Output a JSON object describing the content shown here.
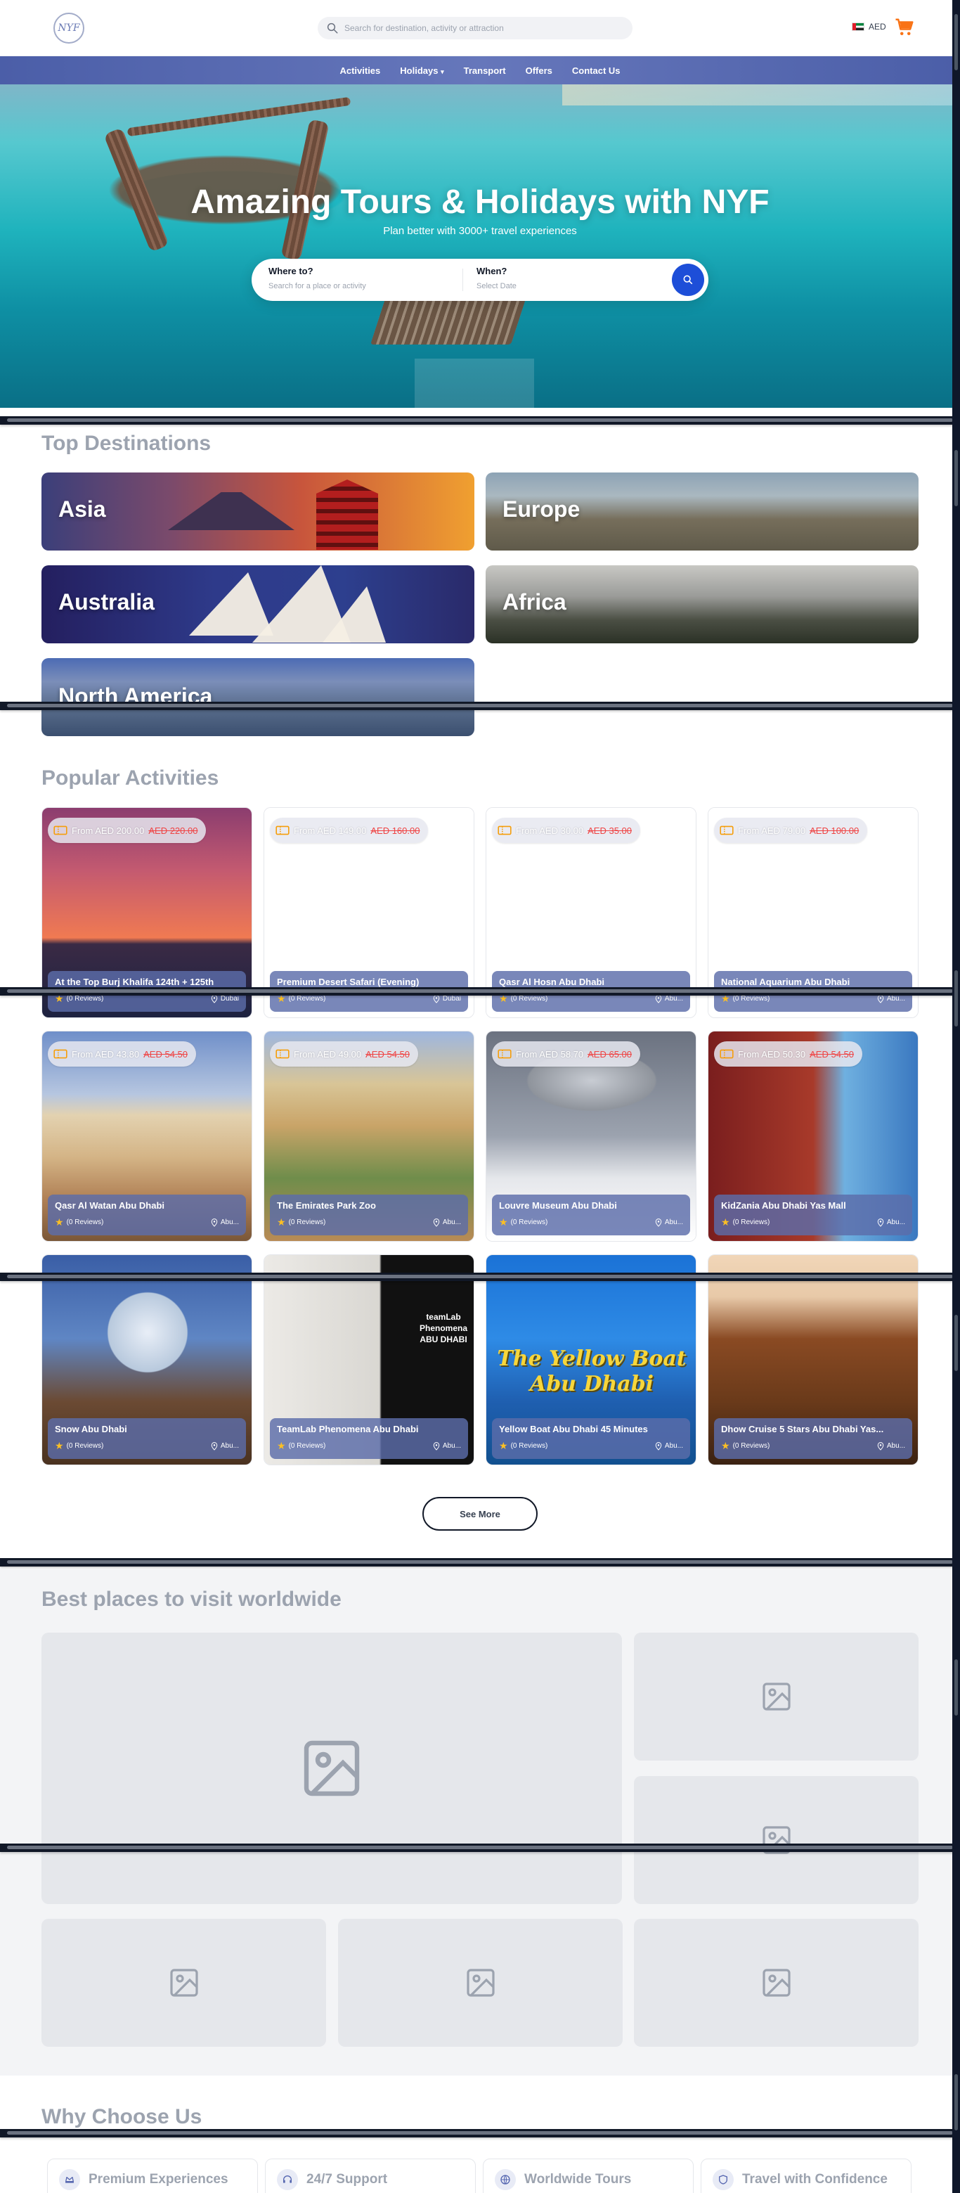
{
  "header": {
    "logo_text": "NYF",
    "search_placeholder": "Search for destination, activity or attraction",
    "currency": "AED"
  },
  "nav": {
    "items": [
      "Activities",
      "Holidays",
      "Transport",
      "Offers",
      "Contact Us"
    ]
  },
  "hero": {
    "title": "Amazing Tours & Holidays with NYF",
    "subtitle": "Plan better with 3000+ travel experiences",
    "where_label": "Where to?",
    "where_placeholder": "Search for a place or activity",
    "when_label": "When?",
    "when_placeholder": "Select Date"
  },
  "destinations": {
    "title": "Top Destinations",
    "items": [
      "Asia",
      "Europe",
      "Australia",
      "Africa",
      "North America"
    ]
  },
  "activities": {
    "title": "Popular Activities",
    "from_prefix": "From",
    "reviews_label": "(0 Reviews)",
    "see_more": "See More",
    "items": [
      {
        "title": "At the Top Burj Khalifa 124th + 125th",
        "price": "AED 200.00",
        "old_price": "AED 220.00",
        "location": "Dubai"
      },
      {
        "title": "Premium Desert Safari (Evening)",
        "price": "AED 149.00",
        "old_price": "AED 160.00",
        "location": "Dubai"
      },
      {
        "title": "Qasr Al Hosn Abu Dhabi",
        "price": "AED 30.00",
        "old_price": "AED 35.00",
        "location": "Abu..."
      },
      {
        "title": "National Aquarium Abu Dhabi",
        "price": "AED 79.00",
        "old_price": "AED 100.00",
        "location": "Abu..."
      },
      {
        "title": "Qasr Al Watan Abu Dhabi",
        "price": "AED 43.80",
        "old_price": "AED 54.50",
        "location": "Abu..."
      },
      {
        "title": "The Emirates Park Zoo",
        "price": "AED 49.00",
        "old_price": "AED 54.50",
        "location": "Abu..."
      },
      {
        "title": "Louvre Museum Abu Dhabi",
        "price": "AED 58.70",
        "old_price": "AED 65.00",
        "location": "Abu..."
      },
      {
        "title": "KidZania Abu Dhabi Yas Mall",
        "price": "AED 50.30",
        "old_price": "AED 54.50",
        "location": "Abu..."
      },
      {
        "title": "Snow Abu Dhabi",
        "price": "",
        "old_price": "",
        "location": "Abu..."
      },
      {
        "title": "TeamLab Phenomena Abu Dhabi",
        "price": "",
        "old_price": "",
        "location": "Abu..."
      },
      {
        "title": "Yellow Boat Abu Dhabi 45 Minutes",
        "price": "",
        "old_price": "",
        "location": "Abu..."
      },
      {
        "title": "Dhow Cruise 5 Stars Abu Dhabi Yas...",
        "price": "",
        "old_price": "",
        "location": "Abu..."
      }
    ],
    "yellow_boat_art": "The Yellow Boat Abu Dhabi",
    "teamlab_sign": "teamLab Phenomena ABU DHABI"
  },
  "best_places": {
    "title": "Best places to visit worldwide"
  },
  "why": {
    "title": "Why Choose Us",
    "features": [
      "Premium Experiences",
      "24/7 Support",
      "Worldwide Tours",
      "Travel with Confidence"
    ]
  },
  "colors": {
    "nav_bg": "#5566b0",
    "accent_blue": "#1d4ed8",
    "section_title": "#9ca3af",
    "strike_red": "#ef4444",
    "cart_orange": "#f97316"
  }
}
